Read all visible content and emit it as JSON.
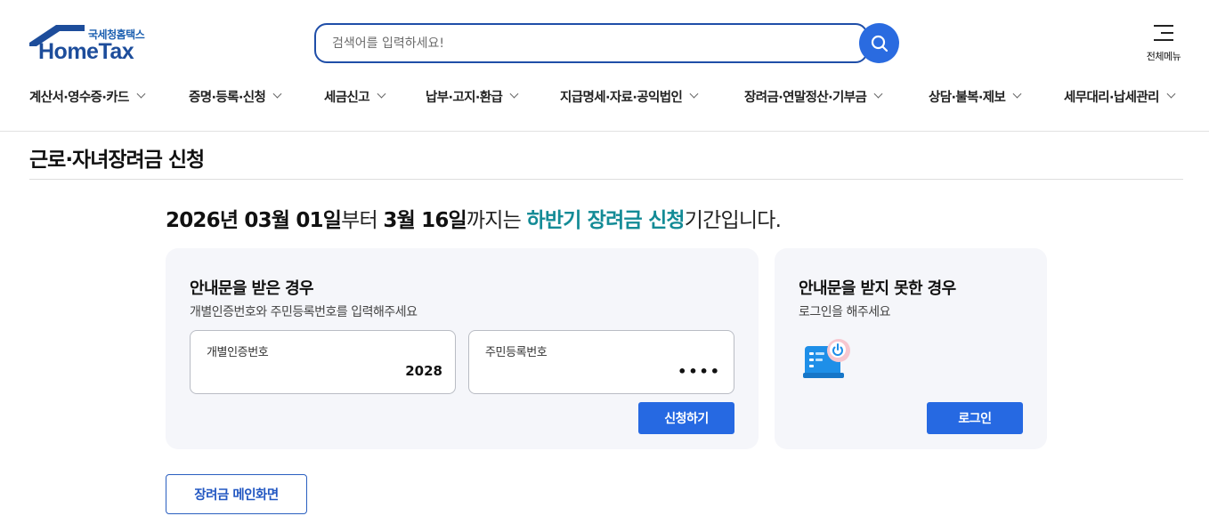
{
  "header": {
    "logo_sub": "국세청홈택스",
    "logo_main": "HomeTax",
    "search_placeholder": "검색어를 입력하세요!",
    "menu_label": "전체메뉴"
  },
  "gnb": {
    "items": [
      {
        "label": "계산서·영수증·카드"
      },
      {
        "label": "증명·등록·신청"
      },
      {
        "label": "세금신고"
      },
      {
        "label": "납부·고지·환급"
      },
      {
        "label": "지급명세·자료·공익법인"
      },
      {
        "label": "장려금·연말정산·기부금"
      },
      {
        "label": "상담·불복·제보"
      },
      {
        "label": "세무대리·납세관리"
      }
    ]
  },
  "page": {
    "title": "근로·자녀장려금 신청"
  },
  "notice": {
    "start_date": "2026년 03월 01일",
    "part1": "부터 ",
    "end_date": "3월 16일",
    "part2": "까지는 ",
    "highlight": "하반기 장려금 신청",
    "part3": "기간입니다."
  },
  "card_with_notice": {
    "title": "안내문을 받은 경우",
    "desc": "개별인증번호와 주민등록번호를 입력해주세요",
    "field1_label": "개별인증번호",
    "field1_value": "2028",
    "field2_label": "주민등록번호",
    "field2_value": "••••",
    "button": "신청하기"
  },
  "card_without_notice": {
    "title": "안내문을 받지 못한 경우",
    "desc": "로그인을 해주세요",
    "button": "로그인"
  },
  "main_link": {
    "label": "장려금 메인화면"
  },
  "colors": {
    "brand": "#1d4d9b",
    "primary_button": "#2669e2",
    "highlight_text": "#138b96",
    "card_bg": "#f5f6fa"
  }
}
